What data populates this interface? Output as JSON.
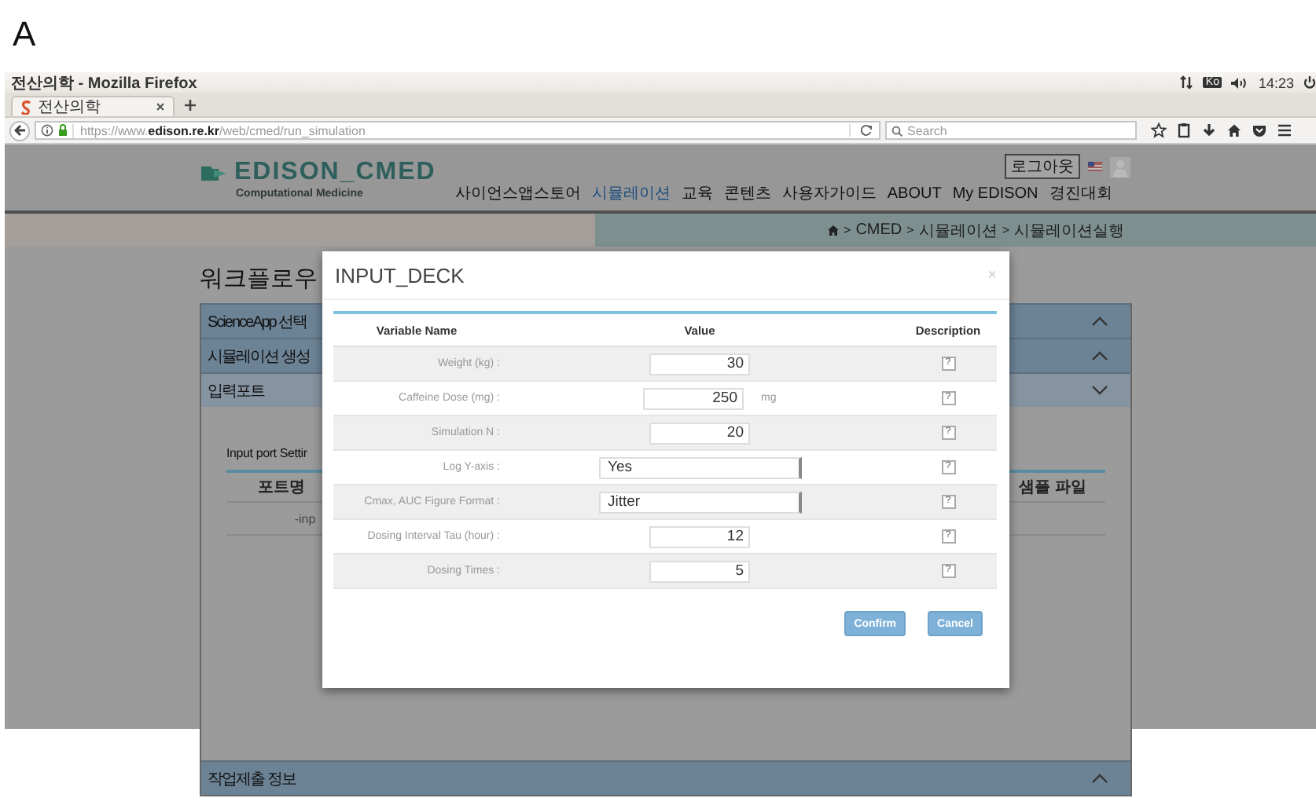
{
  "figure_label": "A",
  "window": {
    "title": "전산의학 - Mozilla Firefox"
  },
  "system_tray": {
    "keyboard": "Ko",
    "time": "14:23"
  },
  "tabs": [
    {
      "label": "전산의학",
      "selected": true
    }
  ],
  "address_bar": {
    "url": "https://www.**edison.re.kr**/web/cmed/run_simulation"
  },
  "search": {
    "placeholder": "Search"
  },
  "site": {
    "logo": "EDISON_CMED",
    "tagline": "Computational Medicine",
    "logout_button": "로그아웃",
    "nav": [
      {
        "label": "사이언스앱스토어",
        "selected": false
      },
      {
        "label": "시뮬레이션",
        "selected": true
      },
      {
        "label": "교육",
        "selected": false
      },
      {
        "label": "콘텐츠",
        "selected": false
      },
      {
        "label": "사용자가이드",
        "selected": false
      },
      {
        "label": "ABOUT",
        "selected": false
      },
      {
        "label": "My EDISON",
        "selected": false
      },
      {
        "label": "경진대회",
        "selected": false
      }
    ],
    "breadcrumb": [
      {
        "separator": ">",
        "label": "CMED"
      },
      {
        "separator": ">",
        "label": "시뮬레이션"
      },
      {
        "separator": ">",
        "label": "시뮬레이션실행"
      }
    ]
  },
  "workflow": {
    "title": "워크플로우",
    "sections": [
      {
        "label": "ScienceApp 선택",
        "expanded": false
      },
      {
        "label": "시뮬레이션 생성",
        "expanded": false
      },
      {
        "label": "입력포트",
        "expanded": true
      },
      {
        "label": "작업제출 정보",
        "expanded": false
      }
    ],
    "input_port": {
      "title": "Input port Settir",
      "columns": [
        "포트명",
        "샘플 파일"
      ],
      "rows": [
        [
          "-inp"
        ]
      ]
    }
  },
  "modal": {
    "title": "INPUT_DECK",
    "close": "×",
    "columns": [
      "Variable Name",
      "Value",
      "Description"
    ],
    "rows": [
      {
        "label": "Weight (kg) :",
        "kind": "number",
        "value": "30",
        "help": "?"
      },
      {
        "label": "Caffeine Dose (mg) :",
        "kind": "number",
        "value": "250",
        "unit": "mg",
        "help": "?"
      },
      {
        "label": "Simulation N :",
        "kind": "number",
        "value": "20",
        "help": "?"
      },
      {
        "label": "Log Y-axis :",
        "kind": "select",
        "value": "Yes",
        "help": "?"
      },
      {
        "label": "Cmax, AUC Figure Format :",
        "kind": "select",
        "value": "Jitter",
        "help": "?"
      },
      {
        "label": "Dosing Interval Tau (hour) :",
        "kind": "number",
        "value": "12",
        "help": "?"
      },
      {
        "label": "Dosing Times :",
        "kind": "number",
        "value": "5",
        "help": "?"
      }
    ],
    "buttons": [
      "Confirm",
      "Cancel"
    ]
  }
}
